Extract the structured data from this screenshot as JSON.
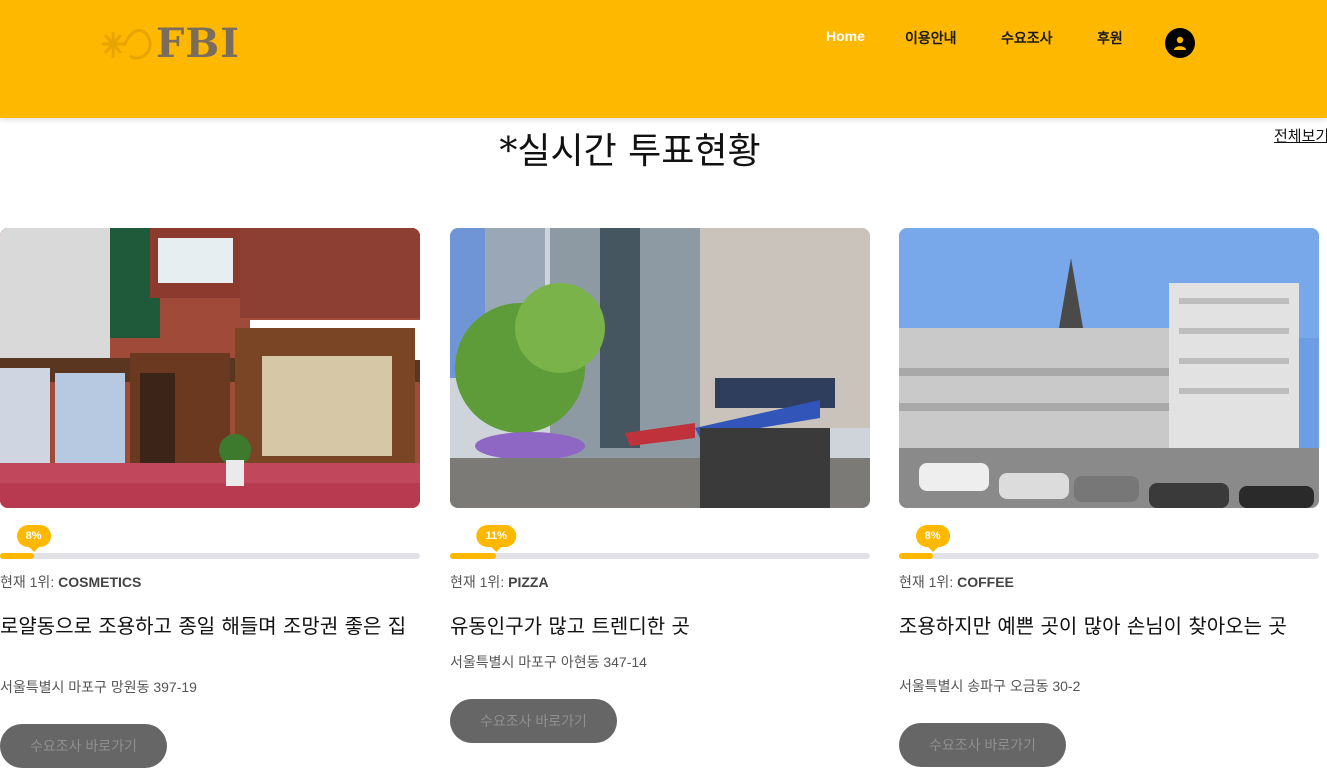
{
  "header": {
    "logo_text": "FBI",
    "nav": [
      {
        "label": "Home",
        "active": true
      },
      {
        "label": "이용안내",
        "active": false
      },
      {
        "label": "수요조사",
        "active": false
      },
      {
        "label": "후원",
        "active": false
      }
    ],
    "user_icon": "user-icon"
  },
  "section": {
    "title": "*실시간 투표현황",
    "view_all": "전체보기"
  },
  "colors": {
    "accent": "#ffb800",
    "button": "#666666"
  },
  "cards": [
    {
      "percent_label": "8%",
      "percent": 8,
      "rank_prefix": "현재 1위: ",
      "rank_value": "COSMETICS",
      "title": "로얄동으로 조용하고 종일 해들며 조망권 좋은 집",
      "address": "서울특별시 마포구 망원동 397-19",
      "button": "수요조사 바로가기",
      "image": "storefront-photo"
    },
    {
      "percent_label": "11%",
      "percent": 11,
      "rank_prefix": "현재 1위: ",
      "rank_value": "PIZZA",
      "title": "유동인구가 많고 트렌디한 곳",
      "address": "서울특별시 마포구 아현동 347-14",
      "button": "수요조사 바로가기",
      "image": "street-photo"
    },
    {
      "percent_label": "8%",
      "percent": 8,
      "rank_prefix": "현재 1위: ",
      "rank_value": "COFFEE",
      "title": "조용하지만 예쁜 곳이 많아 손님이 찾아오는 곳",
      "address": "서울특별시 송파구 오금동 30-2",
      "button": "수요조사 바로가기",
      "image": "building-photo"
    }
  ]
}
